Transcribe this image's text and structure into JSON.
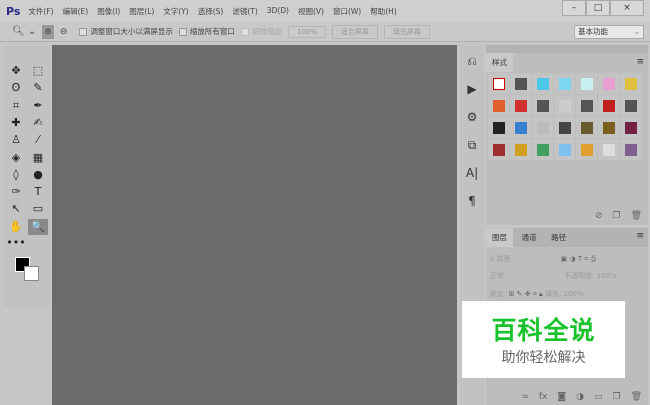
{
  "app": {
    "logo": "Ps"
  },
  "menu": [
    "文件(F)",
    "编辑(E)",
    "图像(I)",
    "图层(L)",
    "文字(Y)",
    "选择(S)",
    "滤镜(T)",
    "3D(D)",
    "视图(V)",
    "窗口(W)",
    "帮助(H)"
  ],
  "window_controls": [
    "–",
    "□",
    "×"
  ],
  "options": {
    "resize_label": "调整窗口大小以满屏显示",
    "zoom_all_label": "缩放所有窗口",
    "scrubby_label": "细微缩放",
    "zoom_pct": "100%",
    "fit_screen": "适合屏幕",
    "fill_screen": "填充屏幕",
    "workspace": "基本功能"
  },
  "tools": [
    "✥",
    "⬚",
    "ʘ",
    "✎",
    "⌗",
    "✒",
    "✚",
    "✍",
    "♙",
    "⁄",
    "◈",
    "▦",
    "◊",
    "●",
    "✑",
    "T",
    "↖",
    "▭",
    "✋",
    "🔍",
    "•••"
  ],
  "styles_panel": {
    "tab": "样式",
    "swatches": [
      "#fff",
      "#555",
      "#4cc8e8",
      "#7fd6f0",
      "#c8f0f0",
      "#e8a0d0",
      "#e0c040",
      "#e06030",
      "#d03030",
      "#555",
      "#ccc",
      "#555",
      "#c02020",
      "#555",
      "#222",
      "#3a80d0",
      "#bbb",
      "#444",
      "#6a5a30",
      "#7a6020",
      "#702040",
      "#a03030",
      "#d0a020",
      "#40a060",
      "#80c0f0",
      "#e0a030",
      "#ddd",
      "#806090"
    ]
  },
  "layers_panel": {
    "tabs": [
      "图层",
      "通道",
      "路径"
    ],
    "filter": "ρ 类型",
    "blend": "正常",
    "opacity_label": "不透明度:",
    "opacity": "100%",
    "lock_label": "锁定:",
    "fill_label": "填充:",
    "fill": "100%"
  },
  "watermark": {
    "title": "百科全说",
    "subtitle": "助你轻松解决"
  }
}
